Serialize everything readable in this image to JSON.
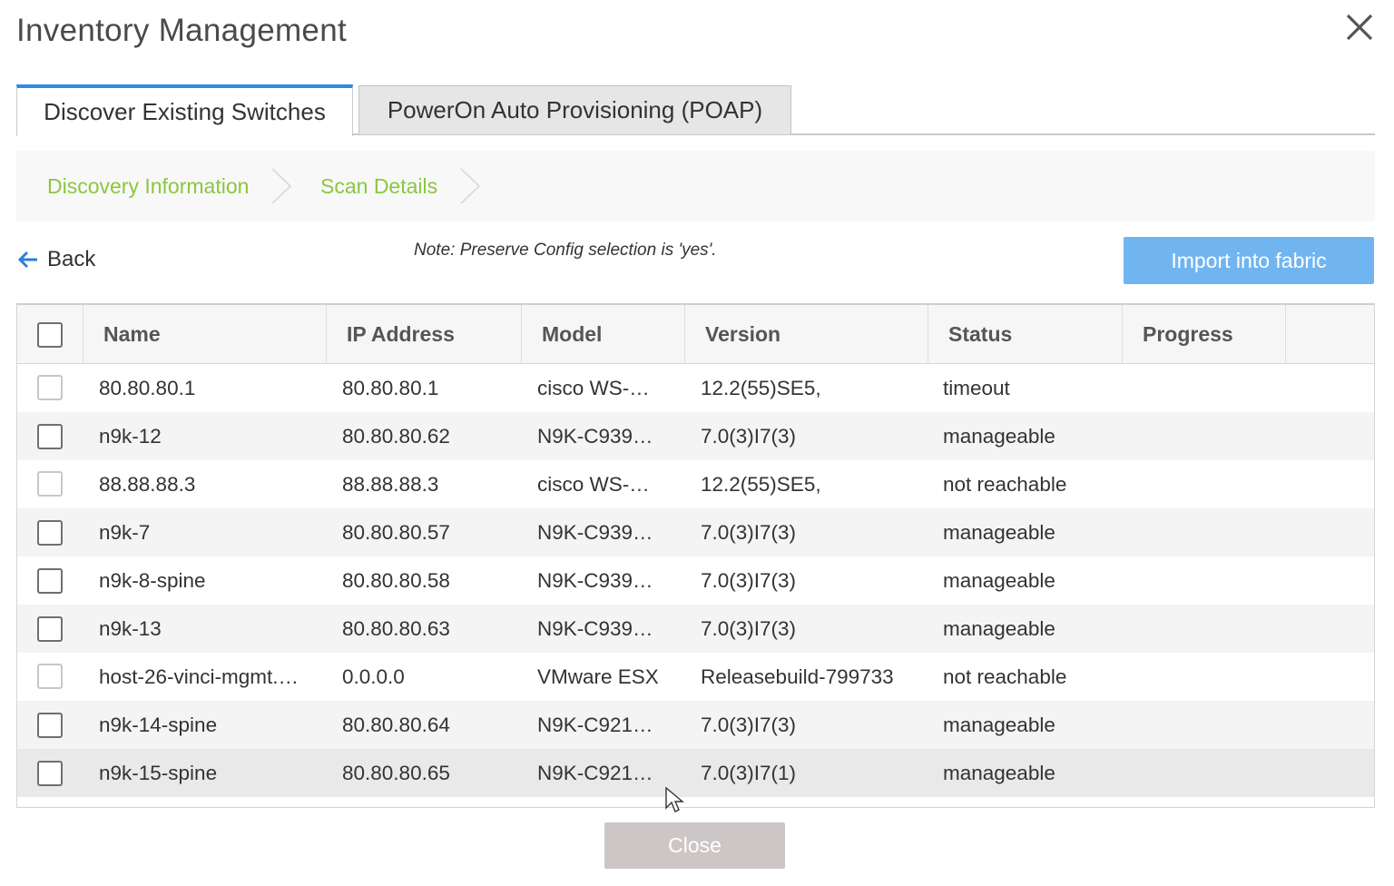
{
  "dialog": {
    "title": "Inventory Management"
  },
  "tabs": [
    {
      "label": "Discover Existing Switches",
      "active": true
    },
    {
      "label": "PowerOn Auto Provisioning (POAP)",
      "active": false
    }
  ],
  "wizard": {
    "steps": [
      "Discovery Information",
      "Scan Details"
    ],
    "color": "#8cc63f"
  },
  "actions": {
    "back_label": "Back",
    "note": "Note: Preserve Config selection is 'yes'.",
    "import_label": "Import into fabric"
  },
  "table": {
    "columns": [
      "Name",
      "IP Address",
      "Model",
      "Version",
      "Status",
      "Progress"
    ],
    "rows": [
      {
        "name": "80.80.80.1",
        "ip": "80.80.80.1",
        "model": "cisco WS-…",
        "version": "12.2(55)SE5,",
        "status": "timeout",
        "progress": "",
        "selectable": false
      },
      {
        "name": "n9k-12",
        "ip": "80.80.80.62",
        "model": "N9K-C939…",
        "version": "7.0(3)I7(3)",
        "status": "manageable",
        "progress": "",
        "selectable": true
      },
      {
        "name": "88.88.88.3",
        "ip": "88.88.88.3",
        "model": "cisco WS-…",
        "version": "12.2(55)SE5,",
        "status": "not reachable",
        "progress": "",
        "selectable": false
      },
      {
        "name": "n9k-7",
        "ip": "80.80.80.57",
        "model": "N9K-C939…",
        "version": "7.0(3)I7(3)",
        "status": "manageable",
        "progress": "",
        "selectable": true
      },
      {
        "name": "n9k-8-spine",
        "ip": "80.80.80.58",
        "model": "N9K-C939…",
        "version": "7.0(3)I7(3)",
        "status": "manageable",
        "progress": "",
        "selectable": true
      },
      {
        "name": "n9k-13",
        "ip": "80.80.80.63",
        "model": "N9K-C939…",
        "version": "7.0(3)I7(3)",
        "status": "manageable",
        "progress": "",
        "selectable": true
      },
      {
        "name": "host-26-vinci-mgmt.…",
        "ip": "0.0.0.0",
        "model": "VMware ESX",
        "version": "Releasebuild-799733",
        "status": "not reachable",
        "progress": "",
        "selectable": false
      },
      {
        "name": "n9k-14-spine",
        "ip": "80.80.80.64",
        "model": "N9K-C921…",
        "version": "7.0(3)I7(3)",
        "status": "manageable",
        "progress": "",
        "selectable": true
      },
      {
        "name": "n9k-15-spine",
        "ip": "80.80.80.65",
        "model": "N9K-C921…",
        "version": "7.0(3)I7(1)",
        "status": "manageable",
        "progress": "",
        "selectable": true
      }
    ]
  },
  "footer": {
    "close_label": "Close"
  },
  "colors": {
    "tab_accent": "#2d8be6",
    "import_button": "#71b5f0",
    "close_button": "#cdc6c6",
    "back_arrow": "#2d7fd8"
  },
  "icons": [
    "close-icon",
    "chevron-right-icon",
    "arrow-left-icon",
    "mouse-cursor-icon"
  ]
}
